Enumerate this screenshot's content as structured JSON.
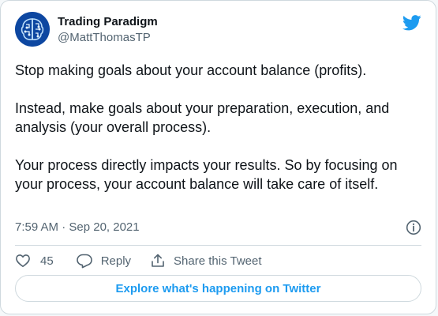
{
  "author": {
    "display_name": "Trading Paradigm",
    "handle": "@MattThomasTP",
    "avatar_icon": "brain-circuit-icon"
  },
  "tweet": {
    "text": "Stop making goals about your account balance (profits).\n\nInstead, make goals about your preparation, execution, and analysis (your overall process).\n\nYour process directly impacts your results. So by focusing on your process, your account balance will take care of itself.",
    "timestamp": "7:59 AM · Sep 20, 2021"
  },
  "actions": {
    "like_count": "45",
    "reply_label": "Reply",
    "share_label": "Share this Tweet"
  },
  "explore_label": "Explore what's happening on Twitter",
  "colors": {
    "twitter_blue": "#1d9bf0",
    "text_primary": "#0f1419",
    "text_secondary": "#536471",
    "border": "#cfd9de",
    "avatar_bg": "#0d47a1"
  },
  "icons": [
    "twitter-bird-icon",
    "info-icon",
    "heart-icon",
    "reply-icon",
    "share-icon"
  ]
}
